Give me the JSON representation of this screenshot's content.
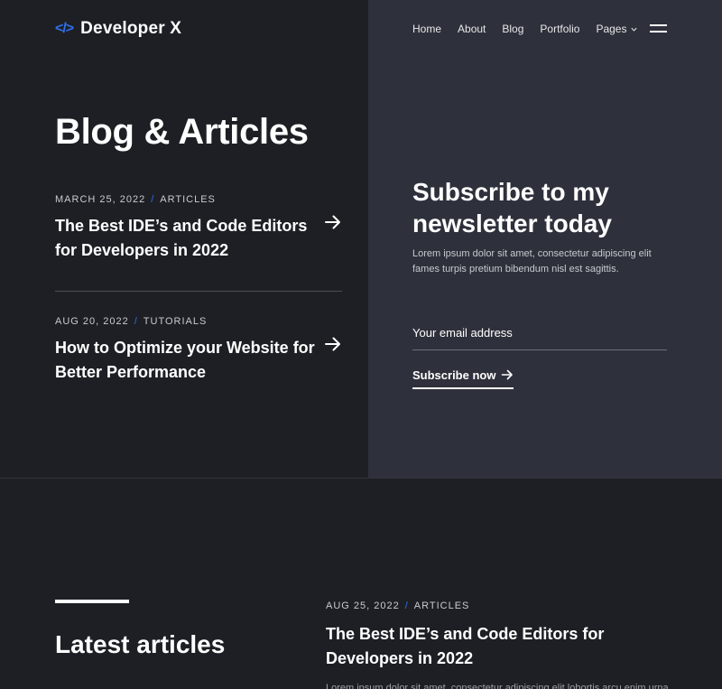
{
  "header": {
    "logo_icon": "</>",
    "logo_text": "Developer X",
    "nav": [
      {
        "label": "Home"
      },
      {
        "label": "About"
      },
      {
        "label": "Blog"
      },
      {
        "label": "Portfolio"
      },
      {
        "label": "Pages"
      }
    ]
  },
  "hero": {
    "title": "Blog & Articles",
    "posts": [
      {
        "date": "MARCH 25, 2022",
        "category": "ARTICLES",
        "title": "The Best IDE’s and Code Editors for Developers in 2022"
      },
      {
        "date": "AUG 20, 2022",
        "category": "TUTORIALS",
        "title": "How to Optimize your Website for Better Performance"
      }
    ]
  },
  "newsletter": {
    "title": "Subscribe to my newsletter today",
    "text": "Lorem ipsum dolor sit amet, consectetur adipiscing elit fames turpis pretium bibendum nisl est sagittis.",
    "email_placeholder": "Your email address",
    "submit_label": "Subscribe now"
  },
  "latest": {
    "title": "Latest articles",
    "post": {
      "date": "AUG 25, 2022",
      "category": "ARTICLES",
      "title": "The Best IDE’s and Code Editors for Developers in 2022",
      "excerpt": "Lorem ipsum dolor sit amet, consectetur adipiscing elit lobortis arcu enim urna"
    }
  },
  "colors": {
    "background_dark": "#1d1f24",
    "background_panel": "#2e313b",
    "accent": "#2f6fea",
    "text": "#ffffff"
  },
  "icons": [
    "code-icon",
    "chevron-down-icon",
    "menu-icon",
    "arrow-right-icon"
  ]
}
